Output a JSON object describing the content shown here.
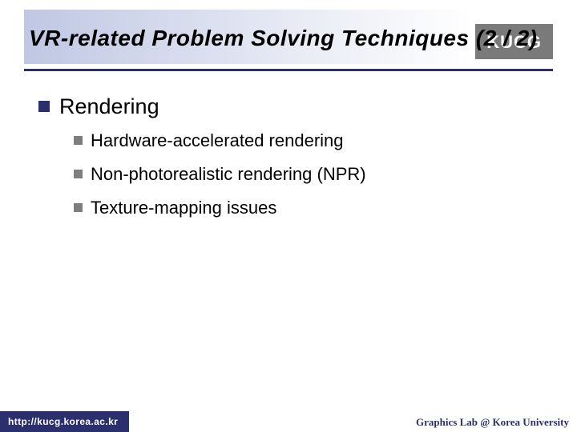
{
  "header": {
    "title": "VR-related Problem Solving Techniques (2 / 2)",
    "badge": "KUCG"
  },
  "content": {
    "heading": "Rendering",
    "items": [
      "Hardware-accelerated rendering",
      "Non-photorealistic rendering (NPR)",
      "Texture-mapping issues"
    ]
  },
  "footer": {
    "left": "http://kucg.korea.ac.kr",
    "right": "Graphics Lab @ Korea University"
  }
}
